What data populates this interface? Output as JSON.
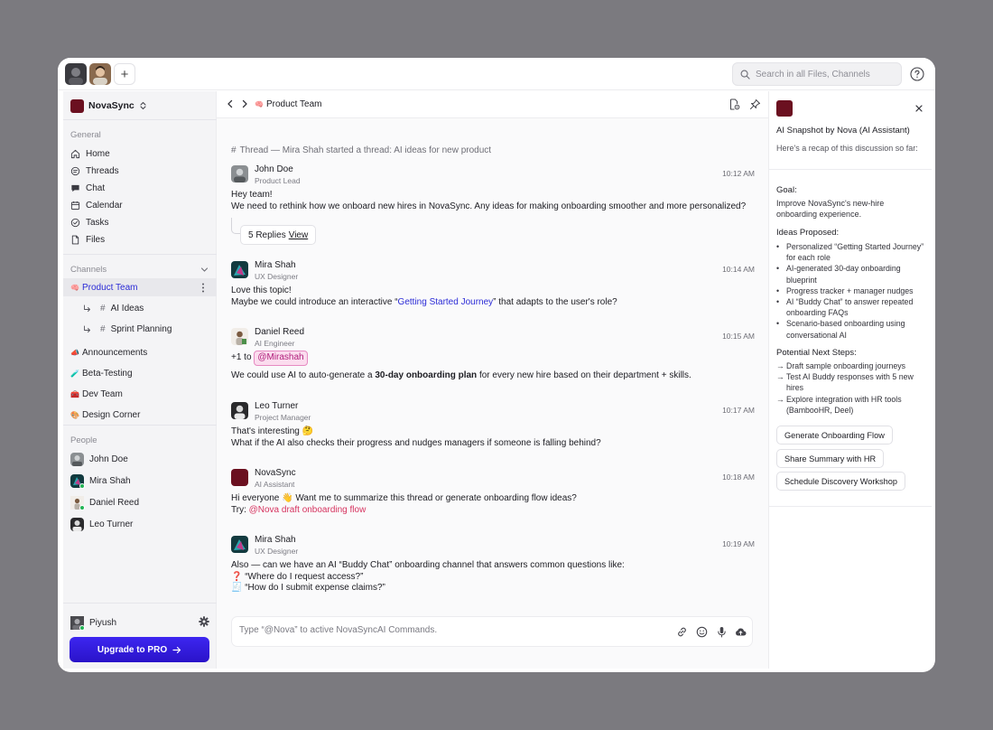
{
  "topbar": {
    "search_placeholder": "Search in all Files, Channels",
    "add_label": "+"
  },
  "sidebar": {
    "workspace_name": "NovaSync",
    "general_label": "General",
    "nav": [
      {
        "label": "Home",
        "icon": "home-icon"
      },
      {
        "label": "Threads",
        "icon": "threads-icon"
      },
      {
        "label": "Chat",
        "icon": "chat-icon"
      },
      {
        "label": "Calendar",
        "icon": "calendar-icon"
      },
      {
        "label": "Tasks",
        "icon": "tasks-icon"
      },
      {
        "label": "Files",
        "icon": "files-icon"
      }
    ],
    "channels_label": "Channels",
    "channels": [
      {
        "emoji": "🧠",
        "label": "Product Team",
        "active": true
      },
      {
        "label": "AI Ideas",
        "sub": true
      },
      {
        "label": "Sprint Planning",
        "sub": true
      },
      {
        "emoji": "📣",
        "label": "Announcements"
      },
      {
        "emoji": "🧪",
        "label": "Beta-Testing"
      },
      {
        "emoji": "🧰",
        "label": "Dev Team"
      },
      {
        "emoji": "🎨",
        "label": "Design Corner"
      }
    ],
    "people_label": "People",
    "people": [
      {
        "name": "John Doe"
      },
      {
        "name": "Mira Shah"
      },
      {
        "name": "Daniel Reed"
      },
      {
        "name": "Leo Turner"
      }
    ],
    "user_name": "Piyush",
    "upgrade_label": "Upgrade to PRO"
  },
  "main": {
    "channel_emoji": "🧠",
    "channel_title": "Product Team",
    "thread_header": "Thread — Mira Shah started a thread: AI ideas for new product",
    "messages": [
      {
        "name": "John Doe",
        "role": "Product Lead",
        "time": "10:12 AM",
        "line1": "Hey team!",
        "line2": "We need to rethink how we onboard new hires in NovaSync. Any ideas for making onboarding smoother and more personalized?",
        "replies_count": "5 Replies",
        "replies_view": "View"
      },
      {
        "name": "Mira Shah",
        "role": "UX Designer",
        "time": "10:14 AM",
        "line1": "Love this topic!",
        "line2_pre": "Maybe we could introduce an interactive “",
        "line2_link": "Getting Started Journey",
        "line2_post": "” that adapts to the user's role?"
      },
      {
        "name": "Daniel Reed",
        "role": "AI Engineer",
        "time": "10:15 AM",
        "line1_pre": "+1 to",
        "mention": "@Mirashah",
        "line2_pre": "We could use AI to auto-generate a ",
        "line2_bold": "30-day onboarding plan",
        "line2_post": " for every new hire based on their department + skills."
      },
      {
        "name": "Leo Turner",
        "role": "Project Manager",
        "time": "10:17 AM",
        "line1": "That's interesting 🤔",
        "line2": "What if the AI also checks their progress and nudges managers if someone is falling behind?"
      },
      {
        "name": "NovaSync",
        "role": "AI Assistant",
        "time": "10:18 AM",
        "line1": "Hi everyone 👋 Want me to summarize this thread or generate onboarding flow ideas?",
        "line2_pre": "Try: ",
        "line2_link": "@Nova draft onboarding flow"
      },
      {
        "name": "Mira Shah",
        "role": "UX Designer",
        "time": "10:19 AM",
        "line1": "Also — can we have an AI “Buddy Chat” onboarding channel that answers common questions like:",
        "line2": "❓ “Where do I request access?”",
        "line3": "🧾 “How do I submit expense claims?”"
      }
    ],
    "composer_placeholder": "Type “@Nova” to active NovaSyncAI Commands."
  },
  "panel": {
    "title": "AI Snapshot by Nova (AI Assistant)",
    "subtitle": "Here's a recap of this discussion so far:",
    "goal_label": "Goal:",
    "goal_text": "Improve NovaSync's new-hire onboarding experience.",
    "ideas_label": "Ideas Proposed:",
    "ideas": [
      "Personalized “Getting Started Journey” for each role",
      "AI-generated 30-day onboarding blueprint",
      "Progress tracker + manager nudges",
      "AI “Buddy Chat” to answer repeated onboarding FAQs",
      "Scenario-based onboarding using conversational AI"
    ],
    "steps_label": "Potential Next Steps:",
    "steps": [
      "Draft sample onboarding journeys",
      "Test AI Buddy responses with 5 new hires",
      "Explore integration with HR tools (BambooHR, Deel)"
    ],
    "buttons": [
      "Generate Onboarding Flow",
      "Share Summary with HR",
      "Schedule Discovery Workshop"
    ]
  },
  "colors": {
    "brand": "#6b1020",
    "accent": "#3d26f0",
    "link": "#2b2bd6",
    "mention": "#b01e7b",
    "online": "#22b455"
  }
}
